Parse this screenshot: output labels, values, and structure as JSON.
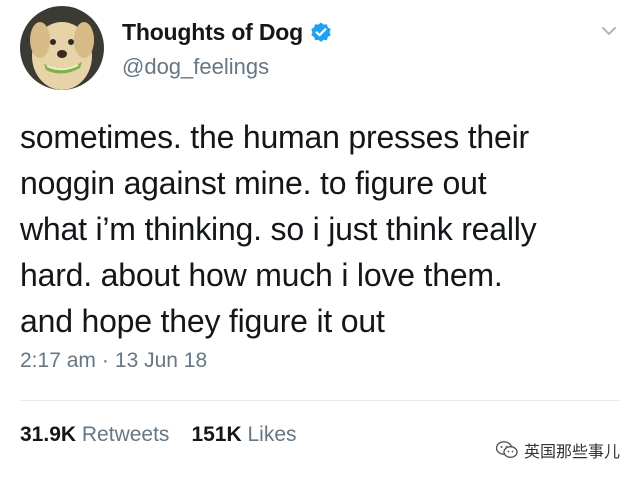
{
  "user": {
    "display_name": "Thoughts of Dog",
    "handle": "@dog_feelings",
    "verified": true
  },
  "tweet": {
    "lines": [
      "sometimes. the human presses their",
      "noggin against mine. to figure out",
      "what i’m thinking. so i just think really",
      "hard. about how much i love them.",
      "and hope they figure it out"
    ],
    "time": "2:17 am",
    "separator": "·",
    "date": "13 Jun 18"
  },
  "stats": {
    "retweets_count": "31.9K",
    "retweets_label": "Retweets",
    "likes_count": "151K",
    "likes_label": "Likes"
  },
  "watermark": {
    "text": "英国那些事儿"
  },
  "icons": {
    "verified": "verified-badge-icon",
    "caret": "chevron-down-icon",
    "watermark": "wechat-icon"
  },
  "colors": {
    "text_primary": "#14171a",
    "text_secondary": "#657786",
    "verified_blue": "#1da1f2",
    "divider": "#e6ecf0"
  }
}
